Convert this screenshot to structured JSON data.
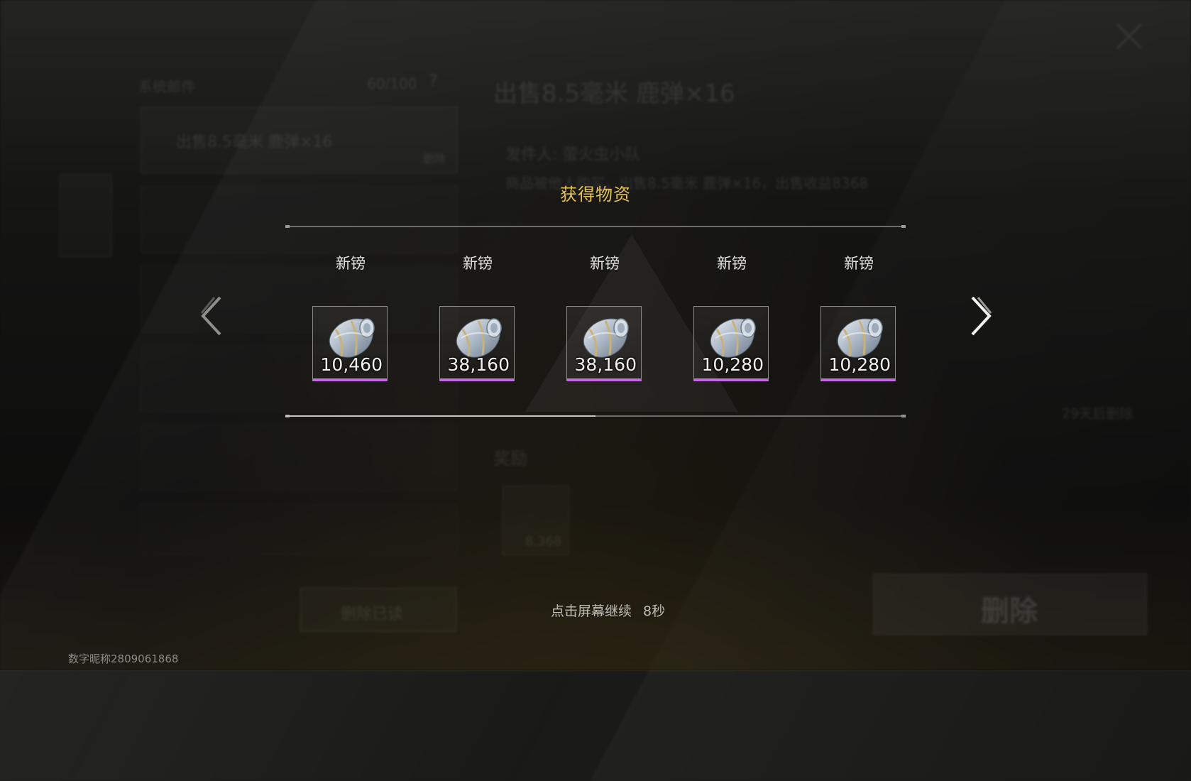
{
  "background": {
    "mail_header": "系统邮件",
    "mail_count": "60/100",
    "help_glyph": "?",
    "mail_item_title": "出售8.5毫米 鹿弹×16",
    "mail_item_action": "删除",
    "detail_title": "出售8.5毫米 鹿弹×16",
    "detail_sender": "发件人: 萤火虫小队",
    "detail_body": "商品被他人购买，出售8.5毫米 鹿弹×16，出售收益8368",
    "reward_header": "奖励",
    "reward_amount": "8,368",
    "expire_note": "29天后删除",
    "delete_read_button": "删除已读",
    "delete_button": "删除"
  },
  "modal": {
    "title": "获得物资",
    "items": [
      {
        "name": "新镑",
        "count": "10,460",
        "rarity_color": "#c867e6",
        "icon": "cash-roll-icon"
      },
      {
        "name": "新镑",
        "count": "38,160",
        "rarity_color": "#c867e6",
        "icon": "cash-roll-icon"
      },
      {
        "name": "新镑",
        "count": "38,160",
        "rarity_color": "#c867e6",
        "icon": "cash-roll-icon"
      },
      {
        "name": "新镑",
        "count": "10,280",
        "rarity_color": "#c867e6",
        "icon": "cash-roll-icon"
      },
      {
        "name": "新镑",
        "count": "10,280",
        "rarity_color": "#c867e6",
        "icon": "cash-roll-icon"
      }
    ],
    "scroll_progress": 0.5,
    "continue_text": "点击屏幕继续",
    "countdown": "8秒"
  },
  "footer": {
    "player_id": "数字昵称2809061868"
  },
  "colors": {
    "title_gold": "#e6c25a",
    "rarity_purple": "#c867e6"
  }
}
